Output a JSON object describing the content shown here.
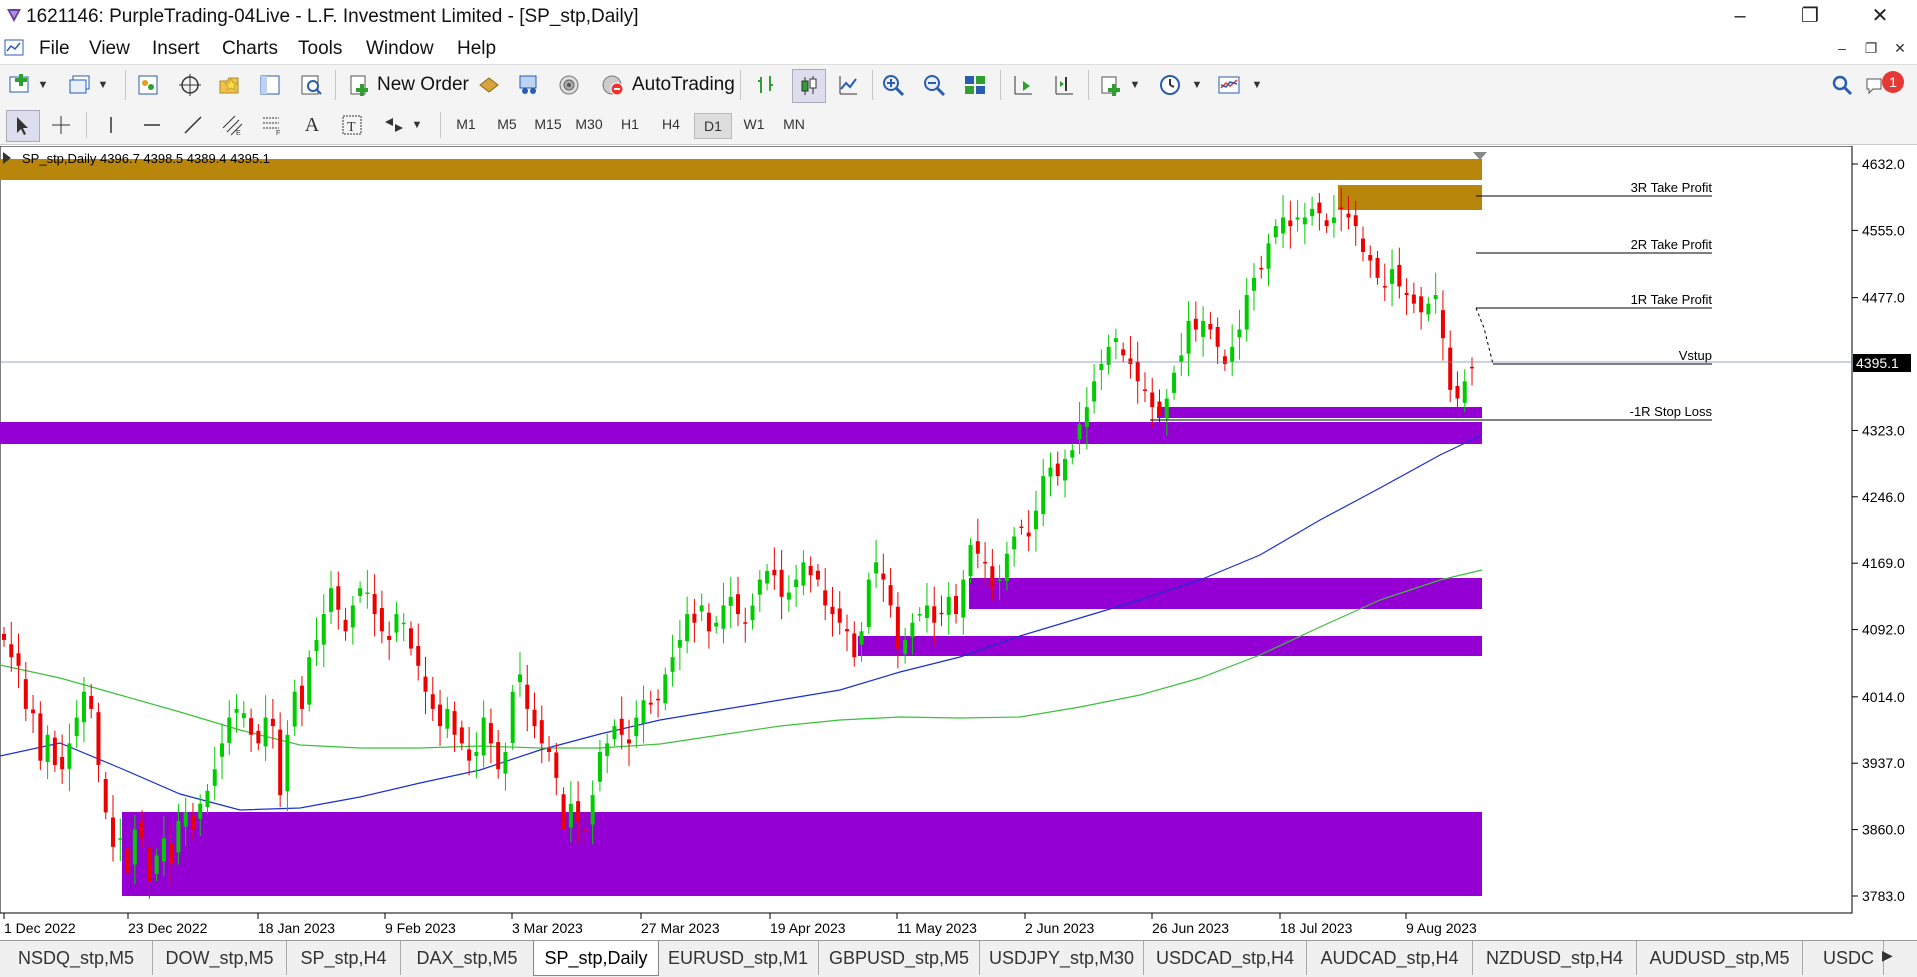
{
  "window": {
    "title": "1621146: PurpleTrading-04Live - L.F. Investment Limited - [SP_stp,Daily]"
  },
  "menu": [
    "File",
    "View",
    "Insert",
    "Charts",
    "Tools",
    "Window",
    "Help"
  ],
  "toolbar": {
    "new_order_label": "New Order",
    "autotrading_label": "AutoTrading",
    "notification_count": "1"
  },
  "timeframes": [
    "M1",
    "M5",
    "M15",
    "M30",
    "H1",
    "H4",
    "D1",
    "W1",
    "MN"
  ],
  "active_timeframe": "D1",
  "chart": {
    "header": "SP_stp,Daily  4396.7 4398.5 4389.4 4395.1",
    "current_price_label": "4395.1",
    "y_ticks": [
      "4632.0",
      "4555.0",
      "4477.0",
      "4323.0",
      "4246.0",
      "4169.0",
      "4092.0",
      "4014.0",
      "3937.0",
      "3860.0",
      "3783.0"
    ],
    "x_ticks": [
      "1 Dec 2022",
      "23 Dec 2022",
      "18 Jan 2023",
      "9 Feb 2023",
      "3 Mar 2023",
      "27 Mar 2023",
      "19 Apr 2023",
      "11 May 2023",
      "2 Jun 2023",
      "26 Jun 2023",
      "18 Jul 2023",
      "9 Aug 2023"
    ],
    "levels": [
      {
        "label": "3R Take Profit"
      },
      {
        "label": "2R Take Profit"
      },
      {
        "label": "1R Take Profit"
      },
      {
        "label": "Vstup"
      },
      {
        "label": "-1R Stop Loss"
      }
    ],
    "colors": {
      "bull": "#00cc00",
      "bear": "#ee0000",
      "zone_purple": "#9400d3",
      "zone_gold": "#b8860b",
      "ma_fast": "#1a2fd4",
      "ma_slow": "#3cc03c"
    }
  },
  "chart_data": {
    "type": "candlestick",
    "symbol": "SP_stp",
    "timeframe": "Daily",
    "last_bar": {
      "open": 4396.7,
      "high": 4398.5,
      "low": 4389.4,
      "close": 4395.1
    },
    "y_axis_ticks": [
      4632.0,
      4555.0,
      4477.0,
      4323.0,
      4246.0,
      4169.0,
      4092.0,
      4014.0,
      3937.0,
      3860.0,
      3783.0
    ],
    "x_axis_ticks": [
      "1 Dec 2022",
      "23 Dec 2022",
      "18 Jan 2023",
      "9 Feb 2023",
      "3 Mar 2023",
      "27 Mar 2023",
      "19 Apr 2023",
      "11 May 2023",
      "2 Jun 2023",
      "26 Jun 2023",
      "18 Jul 2023",
      "9 Aug 2023"
    ]
  },
  "tabs": [
    "NSDQ_stp,M5",
    "DOW_stp,M5",
    "SP_stp,H4",
    "DAX_stp,M5",
    "SP_stp,Daily",
    "EURUSD_stp,M1",
    "GBPUSD_stp,M5",
    "USDJPY_stp,M30",
    "USDCAD_stp,H4",
    "AUDCAD_stp,H4",
    "NZDUSD_stp,H4",
    "AUDUSD_stp,M5",
    "USDC"
  ],
  "active_tab": "SP_stp,Daily"
}
